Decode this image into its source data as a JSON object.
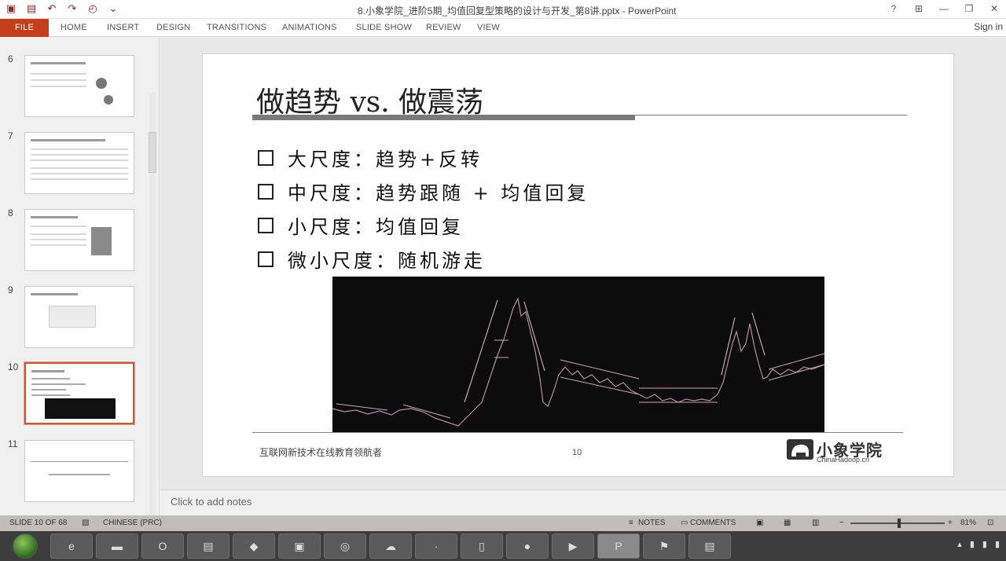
{
  "window": {
    "title": "8.小象学院_进阶5期_均值回复型策略的设计与开发_第8讲.pptx - PowerPoint",
    "sign_in": "Sign in"
  },
  "qat_icons": [
    "powerpoint-icon",
    "save-icon",
    "undo-icon",
    "redo-icon",
    "start-from-beginning-icon",
    "customize-icon"
  ],
  "ribbon": {
    "tabs": [
      "FILE",
      "HOME",
      "INSERT",
      "DESIGN",
      "TRANSITIONS",
      "ANIMATIONS",
      "SLIDE SHOW",
      "REVIEW",
      "VIEW"
    ]
  },
  "thumbnails": [
    {
      "number": "6"
    },
    {
      "number": "7"
    },
    {
      "number": "8"
    },
    {
      "number": "9"
    },
    {
      "number": "10"
    },
    {
      "number": "11"
    }
  ],
  "slide": {
    "title": "做趋势 vs. 做震荡",
    "bullets": [
      "大尺度：趋势+反转",
      "中尺度：趋势跟随 + 均值回复",
      "小尺度：均值回复",
      "微小尺度：随机游走"
    ],
    "footer": "互联网新技术在线教育领航者",
    "page_number": "10",
    "logo_name": "小象学院",
    "logo_site": "ChinaHadoop.cn"
  },
  "notes_placeholder": "Click to add notes",
  "status": {
    "slide_info": "SLIDE 10 OF 68",
    "language": "CHINESE (PRC)",
    "notes_label": "NOTES",
    "comments_label": "COMMENTS",
    "zoom": "81%"
  },
  "taskbar": {
    "items": [
      "ie-icon",
      "cmd-icon",
      "outlook-icon",
      "explorer-icon",
      "app-icon",
      "media-icon",
      "chrome-icon",
      "cloud-icon",
      "app2-icon",
      "notepad-icon",
      "wechat-icon",
      "live-icon",
      "powerpoint-icon",
      "app3-icon",
      "app4-icon"
    ]
  }
}
